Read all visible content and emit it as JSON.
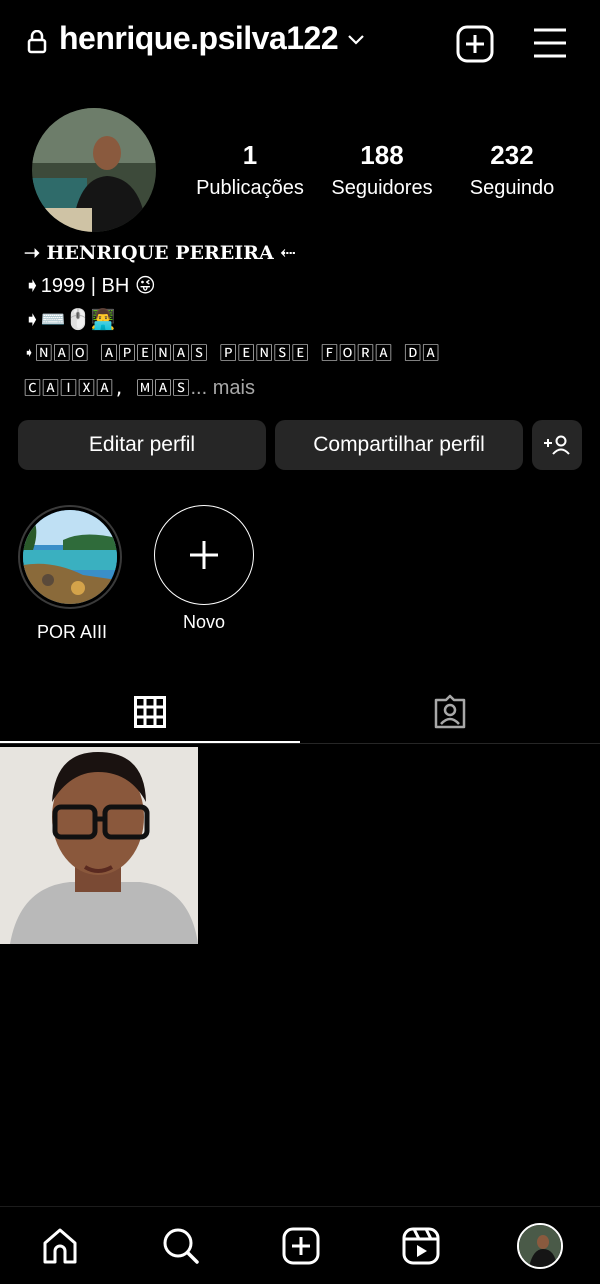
{
  "header": {
    "username": "henrique.psilva122",
    "icons": [
      "lock-icon",
      "chevron-down-icon",
      "plus-square-icon",
      "menu-icon"
    ]
  },
  "profile": {
    "stats": [
      {
        "value": "1",
        "label": "Publicações"
      },
      {
        "value": "188",
        "label": "Seguidores"
      },
      {
        "value": "232",
        "label": "Seguindo"
      }
    ],
    "bio": {
      "name": "➝ HENRIQUE PEREIRA ⇠",
      "line1": "➧1999 | BH 😜",
      "line2": "➧⌨️🖱️👨‍💻",
      "line3": "➧🄽🄰🄾 🄰🄿🄴🄽🄰🅂 🄿🄴🄽🅂🄴 🄵🄾🅁🄰 🄳🄰",
      "line4": "🄲🄰🄸🅇🄰, 🄼🄰🅂",
      "more": "... mais"
    }
  },
  "buttons": {
    "edit": "Editar perfil",
    "share": "Compartilhar perfil"
  },
  "highlights": [
    {
      "label": "POR AIII"
    },
    {
      "label": "Novo"
    }
  ],
  "tabs": [
    "grid-icon",
    "tagged-icon"
  ],
  "nav": [
    "home-icon",
    "search-icon",
    "create-icon",
    "reels-icon",
    "profile-avatar"
  ],
  "colors": {
    "background": "#000000",
    "button_bg": "#262626",
    "muted_text": "#a8a8a8",
    "text": "#ffffff"
  }
}
